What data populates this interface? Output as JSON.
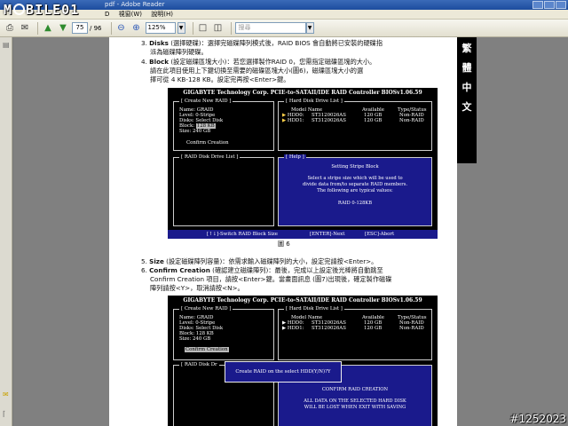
{
  "window": {
    "title_file": "pdf - Adobe Reader",
    "logo": "MOBILE01"
  },
  "menubar": [
    "D",
    "視窗(W)",
    "說明(H)"
  ],
  "toolbar": {
    "page_current": "75",
    "page_total": "/ 96",
    "zoom": "125%",
    "search_placeholder": "搜尋"
  },
  "sidebar_tab": [
    "繁",
    "體",
    "中",
    "文"
  ],
  "doc": {
    "step3": {
      "num": "3.",
      "key": "Disks",
      "text": "(選擇硬碟)：選擇完磁碟陣列模式後，RAID BIOS 會自動將已安裝的硬碟指",
      "text2": "派為磁碟陣列硬碟。"
    },
    "step4": {
      "num": "4.",
      "key": "Block",
      "text": "(設定磁碟區塊大小)：若您選擇製作RAID 0，您需指定磁碟區塊的大小。",
      "text2": "請在此項目使用上下鍵切換至需要的磁碟區塊大小(圖6)，磁碟區塊大小的選",
      "text3": "擇可從 4 KB-128 KB。設定完再按<Enter>鍵。"
    },
    "fig6_caption": "圖 6",
    "step5": {
      "num": "5.",
      "key": "Size",
      "text": "(設定磁碟陣列容量)：依需求輸入磁碟陣列的大小，設定完請按<Enter>。"
    },
    "step6": {
      "num": "6.",
      "key": "Confirm Creation",
      "text": "(確認建立磁碟陣列)：最後，完成以上設定後光棒將自動跳至",
      "text2": "Confirm Creation 項目，請按<Enter>鍵。當畫面訊息 (圖7)出現後，確定製作磁碟",
      "text3": "陣列請按<Y>，取消請按<N>。"
    }
  },
  "bios1": {
    "header": "GIGABYTE Technology Corp. PCIE-to-SATAII/IDE RAID Controller BIOSv1.06.59",
    "create_title": "[ Create New RAID ]",
    "fields": [
      {
        "label": "Name:",
        "value": "GRAID"
      },
      {
        "label": "Level:",
        "value": "0-Stripe"
      },
      {
        "label": "Disks:",
        "value": "Select Disk"
      },
      {
        "label": "Block:",
        "value": "128 KB"
      },
      {
        "label": "Size:",
        "value": "240 GB"
      }
    ],
    "confirm": "Confirm Creation",
    "hdd_title": "[ Hard Disk Drive List ]",
    "hdd_cols": [
      "Model Name",
      "Available",
      "Type/Status"
    ],
    "hdds": [
      {
        "id": "HDD0:",
        "model": "ST3120026AS",
        "avail": "120 GB",
        "type": "Non-RAID"
      },
      {
        "id": "HDD1:",
        "model": "ST3120026AS",
        "avail": "120 GB",
        "type": "Non-RAID"
      }
    ],
    "raid_list_title": "[ RAID Disk Drive List ]",
    "help_title": "[ Help ]",
    "help_lines": [
      "Setting Stripe Block",
      "",
      "Select a stripe size which will be used to",
      "divide data from/to separate RAID members.",
      "The following are typical values:",
      "",
      "RAID 0-128KB"
    ],
    "footer": [
      "[↑↓]-Switch RAID Block Size",
      "[ENTER]-Next",
      "[ESC]-Abort"
    ]
  },
  "bios2": {
    "header": "GIGABYTE Technology Corp. PCIE-to-SATAII/IDE RAID Controller BIOSv1.06.59",
    "create_title": "[ Create New RAID ]",
    "fields": [
      {
        "label": "Name:",
        "value": "GRAID"
      },
      {
        "label": "Level:",
        "value": "0-Stripe"
      },
      {
        "label": "Disks:",
        "value": "Select Disk"
      },
      {
        "label": "Block:",
        "value": "128 KB"
      },
      {
        "label": "Size:",
        "value": "240 GB"
      }
    ],
    "confirm": "Confirm Creation",
    "hdd_title": "[ Hard Disk Drive List ]",
    "hdd_cols": [
      "Model Name",
      "Available",
      "Type/Status"
    ],
    "hdds": [
      {
        "id": "HDD0:",
        "model": "ST3120026AS",
        "avail": "120 GB",
        "type": "Non-RAID"
      },
      {
        "id": "HDD1:",
        "model": "ST3120026AS",
        "avail": "120 GB",
        "type": "Non-RAID"
      }
    ],
    "raid_list_title": "[ RAID Disk Dr",
    "popup": "Create RAID on the select HDD(Y/N)?Y",
    "help_lines": [
      "CONFIRM RAID CREATION",
      "",
      "ALL DATA ON THE SELECTED HARD DISK",
      "WILL BE LOST WHEN EXIT WITH SAVING"
    ]
  },
  "watermark": "#1252023"
}
